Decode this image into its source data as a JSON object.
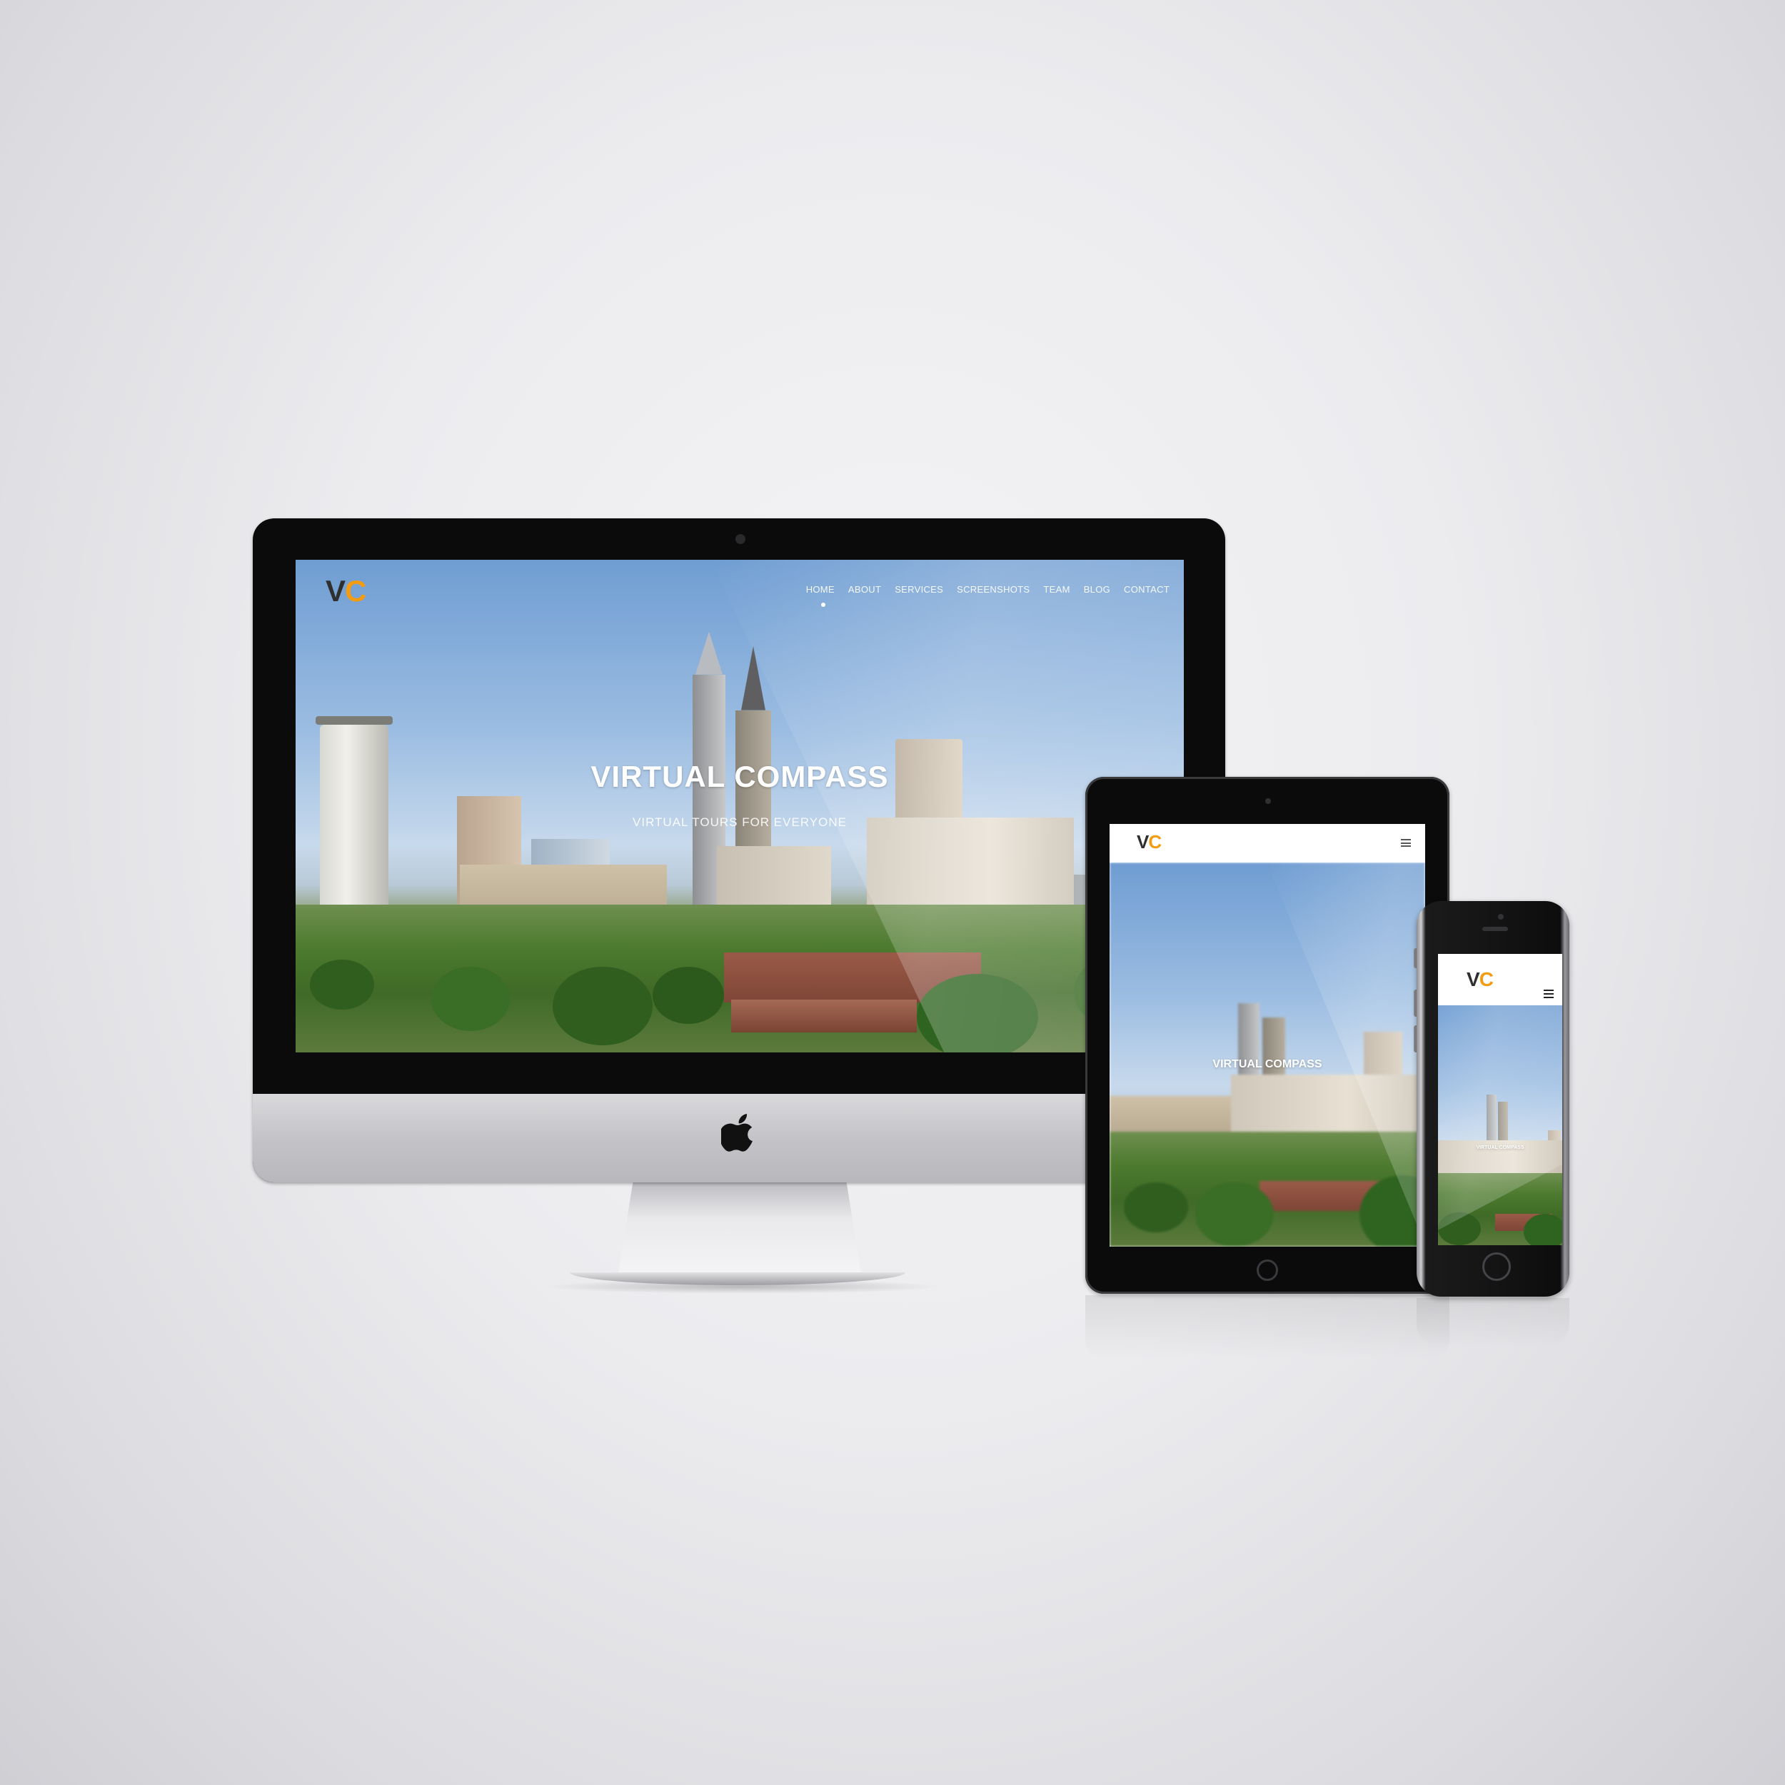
{
  "site": {
    "logo": {
      "v": "V",
      "c": "C"
    },
    "nav": [
      "HOME",
      "ABOUT",
      "SERVICES",
      "SCREENSHOTS",
      "TEAM",
      "BLOG",
      "CONTACT"
    ],
    "active_nav": "HOME",
    "hero_title": "VIRTUAL COMPASS",
    "hero_subtitle": "VIRTUAL TOURS FOR EVERYONE"
  },
  "colors": {
    "accent": "#f39c12",
    "logo_dark": "#2f2f2f",
    "device_frame": "#0b0b0c",
    "imac_chin": "#c4c4c8"
  },
  "icons": {
    "apple": "apple-logo-icon",
    "menu": "hamburger-menu-icon"
  }
}
